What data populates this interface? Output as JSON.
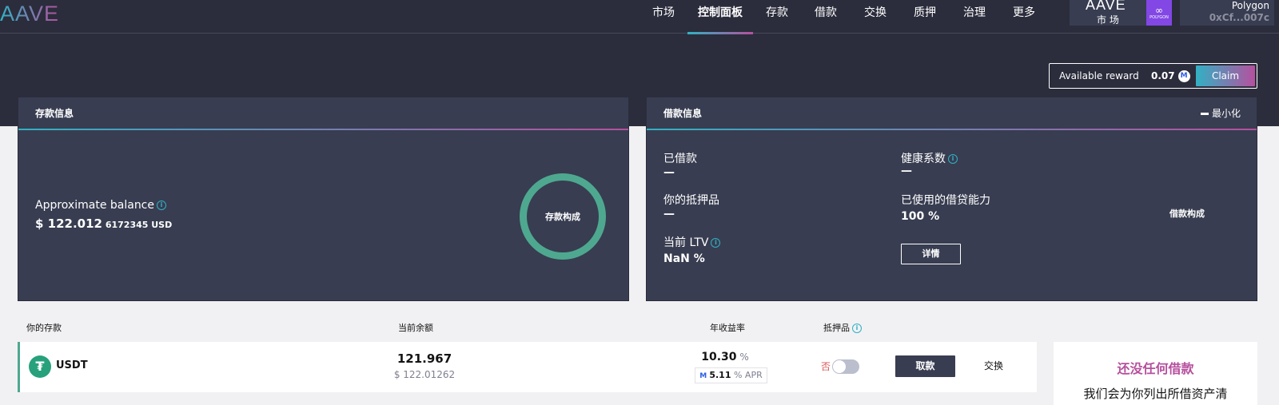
{
  "header": {
    "logo": "AAVE",
    "nav": [
      {
        "label": "市场",
        "name": "nav-markets",
        "width": 60,
        "active": false
      },
      {
        "label": "控制面板",
        "name": "nav-dashboard",
        "width": 82,
        "active": true
      },
      {
        "label": "存款",
        "name": "nav-deposit",
        "width": 60,
        "active": false
      },
      {
        "label": "借款",
        "name": "nav-borrow",
        "width": 62,
        "active": false
      },
      {
        "label": "交换",
        "name": "nav-swap",
        "width": 62,
        "active": false
      },
      {
        "label": "质押",
        "name": "nav-stake",
        "width": 62,
        "active": false
      },
      {
        "label": "治理",
        "name": "nav-governance",
        "width": 62,
        "active": false
      },
      {
        "label": "更多",
        "name": "nav-more",
        "width": 62,
        "active": false
      }
    ],
    "market": {
      "logo": "AAVE",
      "label": "市 场",
      "network_badge": "POLYGON"
    },
    "wallet": {
      "network": "Polygon",
      "address": "0xCf...007c"
    }
  },
  "reward": {
    "label": "Available reward",
    "value": "0.07",
    "claim_label": "Claim"
  },
  "deposit_panel": {
    "title": "存款信息",
    "approx_label": "Approximate balance",
    "balance_prefix": "$ ",
    "balance_main": "122.012",
    "balance_rest": " 6172345 USD",
    "composition_label": "存款构成"
  },
  "borrow_panel": {
    "title": "借款信息",
    "minimize_label": "最小化",
    "borrowed_label": "已借款",
    "borrowed_value": "—",
    "collateral_label": "你的抵押品",
    "collateral_value": "—",
    "ltv_label": "当前 LTV",
    "ltv_value": "NaN %",
    "health_label": "健康系数",
    "health_value": "—",
    "used_power_label": "已使用的借贷能力",
    "used_power_value": "100 %",
    "details_label": "详情",
    "composition_label": "借款构成"
  },
  "deposits_table": {
    "headers": {
      "asset": "你的存款",
      "balance": "当前余额",
      "apy": "年收益率",
      "collateral": "抵押品"
    },
    "rows": [
      {
        "symbol": "USDT",
        "icon_glyph": "₮",
        "balance": "121.967",
        "balance_usd": "$ 122.01262",
        "apy": "10.30",
        "apy_unit": " %",
        "reward_apr": "5.11",
        "reward_apr_unit": " % APR",
        "collateral_state": "否",
        "collateral_enabled": false,
        "withdraw_label": "取款",
        "swap_label": "交换"
      }
    ]
  },
  "no_borrows": {
    "title": "还没任何借款",
    "description": "我们会为你列出所借资产清"
  },
  "colors": {
    "dark_bg": "#2b2d3c",
    "panel_bg": "#383d51",
    "gradient_start": "#31b1c4",
    "gradient_end": "#b6509e",
    "donut": "#4ea88f",
    "polygon": "#8247e5",
    "usdt": "#26a17b",
    "negative": "#de5959"
  }
}
